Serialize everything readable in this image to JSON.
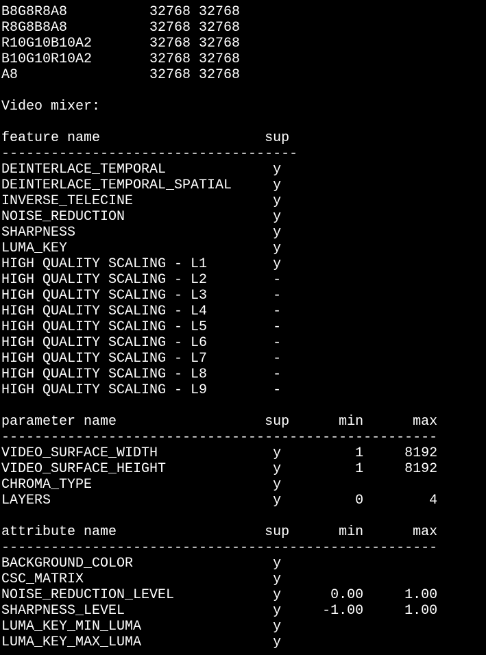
{
  "terminal": {
    "lines": [
      "B8G8R8A8          32768 32768",
      "R8G8B8A8          32768 32768",
      "R10G10B10A2       32768 32768",
      "B10G10R10A2       32768 32768",
      "A8                32768 32768",
      "",
      "Video mixer:",
      "",
      "feature name                    sup",
      "------------------------------------",
      "DEINTERLACE_TEMPORAL             y",
      "DEINTERLACE_TEMPORAL_SPATIAL     y",
      "INVERSE_TELECINE                 y",
      "NOISE_REDUCTION                  y",
      "SHARPNESS                        y",
      "LUMA_KEY                         y",
      "HIGH QUALITY SCALING - L1        y",
      "HIGH QUALITY SCALING - L2        -",
      "HIGH QUALITY SCALING - L3        -",
      "HIGH QUALITY SCALING - L4        -",
      "HIGH QUALITY SCALING - L5        -",
      "HIGH QUALITY SCALING - L6        -",
      "HIGH QUALITY SCALING - L7        -",
      "HIGH QUALITY SCALING - L8        -",
      "HIGH QUALITY SCALING - L9        -",
      "",
      "parameter name                  sup      min      max",
      "-----------------------------------------------------",
      "VIDEO_SURFACE_WIDTH              y         1     8192",
      "VIDEO_SURFACE_HEIGHT             y         1     8192",
      "CHROMA_TYPE                      y",
      "LAYERS                           y         0        4",
      "",
      "attribute name                  sup      min      max",
      "-----------------------------------------------------",
      "BACKGROUND_COLOR                 y",
      "CSC_MATRIX                       y",
      "NOISE_REDUCTION_LEVEL            y      0.00     1.00",
      "SHARPNESS_LEVEL                  y     -1.00     1.00",
      "LUMA_KEY_MIN_LUMA                y",
      "LUMA_KEY_MAX_LUMA                y"
    ]
  }
}
